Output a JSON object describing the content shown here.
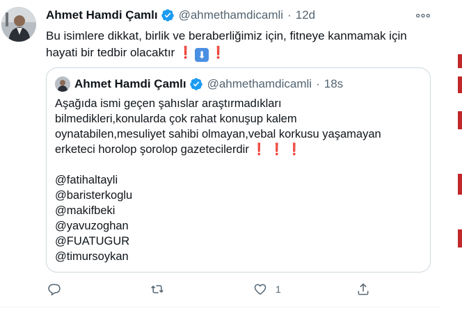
{
  "tweet": {
    "author_name": "Ahmet Hamdi Çamlı",
    "author_handle": "@ahmethamdicamli",
    "separator": "·",
    "time": "12d",
    "text": "Bu isimlere dikkat, birlik ve beraberliğimiz için, fitneye kanmamak için hayati bir tedbir olacaktır",
    "emojis": [
      "❗",
      "⬇",
      "❗"
    ],
    "icons": {
      "verified": "verified-badge-icon",
      "more": "more-options-icon"
    }
  },
  "quoted_tweet": {
    "author_name": "Ahmet Hamdi Çamlı",
    "author_handle": "@ahmethamdicamli",
    "separator": "·",
    "time": "18s",
    "line1": "Aşağıda ismi geçen şahıslar araştırmadıkları",
    "line2": "bilmedikleri,konularda çok rahat konuşup kalem",
    "line3": "oynatabilen,mesuliyet sahibi olmayan,vebal korkusu yaşamayan",
    "line4": "erketeci horolop şorolop gazetecilerdir",
    "line4_emojis": [
      "❗",
      "❗",
      "❗"
    ],
    "mentions": [
      "@fatihaltayli",
      "@baristerkoglu",
      "@makifbeki",
      "@yavuzoghan",
      "@FUATUGUR",
      "@timursoykan"
    ]
  },
  "actions": {
    "reply_count": "",
    "retweet_count": "",
    "like_count": "1",
    "share_count": "",
    "icons": [
      "reply-icon",
      "retweet-icon",
      "like-icon",
      "share-icon"
    ]
  },
  "colors": {
    "text_primary": "#0f1419",
    "text_secondary": "#536471",
    "verified_blue": "#1d9bf0",
    "border": "#cfd9de",
    "emoji_red": "#e0202c"
  }
}
